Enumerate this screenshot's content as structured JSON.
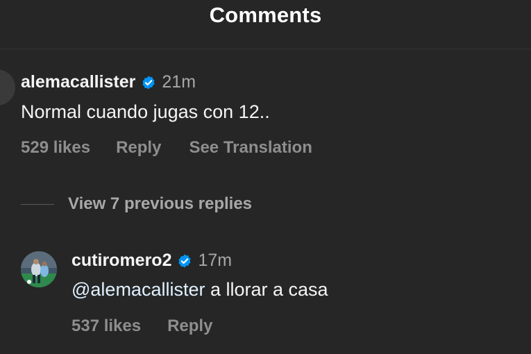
{
  "header": {
    "title": "Comments"
  },
  "comments": [
    {
      "username": "alemacallister",
      "verified": true,
      "time": "21m",
      "text": "Normal cuando jugas con 12..",
      "likes": "529 likes",
      "reply_label": "Reply",
      "translate_label": "See Translation"
    }
  ],
  "view_replies": {
    "label": "View 7 previous replies"
  },
  "replies": [
    {
      "username": "cutiromero2",
      "verified": true,
      "time": "17m",
      "mention": "@alemacallister",
      "text": " a llorar a casa",
      "likes": "537 likes",
      "reply_label": "Reply"
    }
  ],
  "colors": {
    "background": "#262626",
    "verified_badge": "#0095f6",
    "secondary_text": "#8e8e8e"
  }
}
